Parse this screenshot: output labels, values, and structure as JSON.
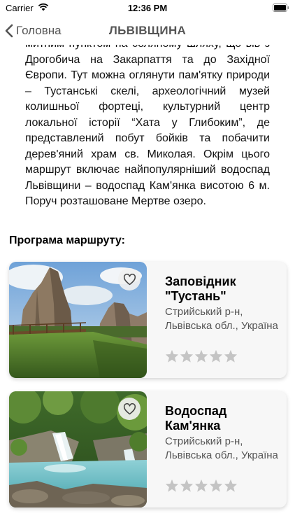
{
  "status_bar": {
    "carrier": "Carrier",
    "time": "12:36 PM"
  },
  "nav": {
    "back_label": "Головна",
    "title": "ЛЬВІВЩИНА"
  },
  "description": "митним пунктом на соляному шляху, що вів з Дрогобича на Закарпаття та до Західної Європи. Тут можна оглянути пам'ятку природи – Тустанські скелі, археологічний музей колишньої фортеці, культурний центр локальної історії “Хата у Глибоким”, де представлений побут бойків та побачити дерев'яний храм св. Миколая. Окрім цього маршрут включає найпопулярніший водоспад Львівщини – водоспад Кам'янка висотою 6 м. Поруч розташоване Мертве озеро.",
  "program_heading": "Програма маршруту:",
  "cards": [
    {
      "title": "Заповідник \"Тустань\"",
      "location": "Стрийський р-н, Львівська обл., Україна",
      "rating": 0,
      "icon": "heart-outline-icon"
    },
    {
      "title": "Водоспад Кам'янка",
      "location": "Стрийський р-н, Львівська обл., Україна",
      "rating": 0,
      "icon": "heart-outline-icon"
    }
  ],
  "colors": {
    "star_empty": "#c4c4c4",
    "card_bg": "#f7f7f7",
    "nav_text": "#555555"
  }
}
